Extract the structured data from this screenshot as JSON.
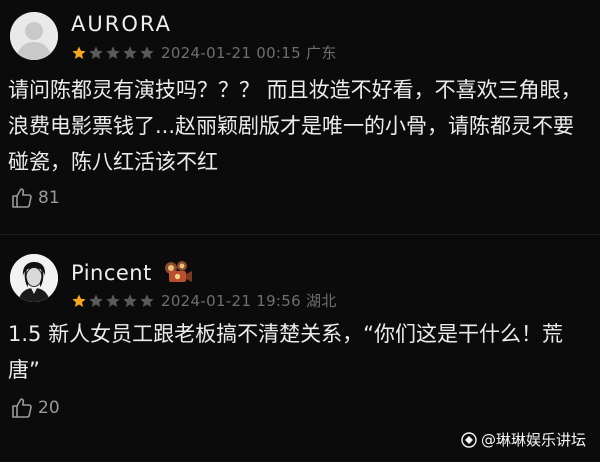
{
  "comments": [
    {
      "username": "AURORA",
      "rating": 1,
      "max_rating": 5,
      "date": "2024-01-21 00:15 广东",
      "text": "请问陈都灵有演技吗？？？ 而且妆造不好看，不喜欢三角眼，浪费电影票钱了...赵丽颖剧版才是唯一的小骨，请陈都灵不要碰瓷，陈八红活该不红",
      "likes": "81",
      "avatar_icon": "default-avatar-icon"
    },
    {
      "username": "Pincent",
      "rating": 1,
      "max_rating": 5,
      "date": "2024-01-21 19:56 湖北",
      "text": "1.5 新人女员工跟老板搞不清楚关系，“你们这是干什么！荒唐”",
      "likes": "20",
      "avatar_icon": "portrait-avatar-icon",
      "badge_icon": "camera-badge-icon"
    }
  ],
  "watermark": "@琳琳娱乐讲坛",
  "colors": {
    "background": "#0b0b0b",
    "star_filled": "#f5a623",
    "star_empty": "#5a5a5a",
    "meta_text": "#6f6f6f"
  }
}
